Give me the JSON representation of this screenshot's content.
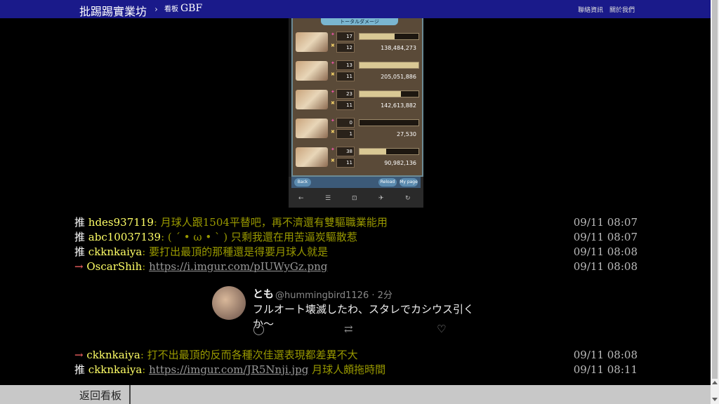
{
  "topbar": {
    "brand": "批踢踢實業坊",
    "separator": "›",
    "board_prefix": "看板",
    "board_name": "GBF",
    "links": [
      "聯絡資訊",
      "關於我們"
    ]
  },
  "game_screenshot": {
    "banner": "トータルダメージ",
    "rows": [
      {
        "stat1": "17",
        "stat2": "12",
        "bar_fill_pct": 60,
        "damage": "138,484,273"
      },
      {
        "stat1": "13",
        "stat2": "11",
        "bar_fill_pct": 100,
        "damage": "205,051,886"
      },
      {
        "stat1": "23",
        "stat2": "11",
        "bar_fill_pct": 70,
        "damage": "142,613,882"
      },
      {
        "stat1": "0",
        "stat2": "1",
        "bar_fill_pct": 0,
        "damage": "27,530"
      },
      {
        "stat1": "38",
        "stat2": "11",
        "bar_fill_pct": 45,
        "damage": "90,982,136"
      }
    ],
    "nav_buttons": [
      "Back",
      "Reload",
      "My page"
    ]
  },
  "pushes_top": [
    {
      "tag": "推",
      "user": "hdes937119",
      "content": ": 月球人跟1504平替吧，再不濟還有雙驅職業能用",
      "link": "",
      "suffix": "",
      "time": "09/11 08:07"
    },
    {
      "tag": "推",
      "user": "abc10037139",
      "content": ": ( ´ • ω • ` ) 只剩我還在用苦逼炭驅散惹",
      "link": "",
      "suffix": "",
      "time": "09/11 08:07"
    },
    {
      "tag": "推",
      "user": "ckknkaiya",
      "content": ": 要打出最頂的那種還是得要月球人就是",
      "link": "",
      "suffix": "",
      "time": "09/11 08:08"
    },
    {
      "tag": "→",
      "user": "OscarShih",
      "content": ": ",
      "link": "https://i.imgur.com/pIUWyGz.png",
      "suffix": "",
      "time": "09/11 08:08"
    }
  ],
  "tweet": {
    "name": "とも",
    "handle": "@hummingbird1126 · 2分",
    "text": "フルオート壊滅したわ、スタレでカシウス引くか〜",
    "icons": [
      "reply-icon",
      "retweet-icon",
      "like-icon"
    ]
  },
  "pushes_bottom": [
    {
      "tag": "→",
      "user": "ckknkaiya",
      "content": ": 打不出最頂的反而各種次佳選表現都差異不大",
      "link": "",
      "suffix": "",
      "time": "09/11 08:08"
    },
    {
      "tag": "推",
      "user": "ckknkaiya",
      "content": ": ",
      "link": "https://imgur.com/JR5Nnji.jpg",
      "suffix": " 月球人頗拖時間",
      "time": "09/11 08:11"
    }
  ],
  "bottombar": {
    "back_label": "返回看板"
  }
}
